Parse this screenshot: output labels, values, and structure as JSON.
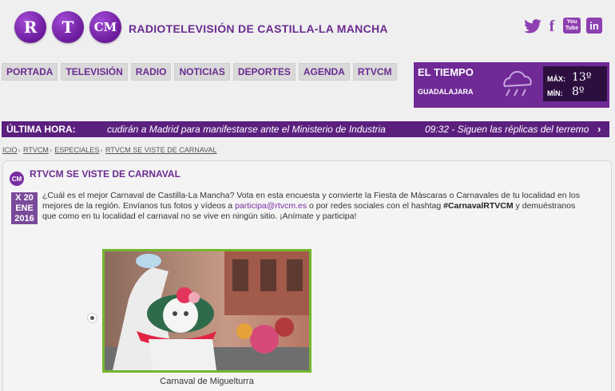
{
  "header": {
    "logo": [
      "R",
      "T",
      "CM"
    ],
    "brand": "RADIOTELEVISIÓN DE CASTILLA-LA MANCHA",
    "social": {
      "youtube_top": "You",
      "youtube_bottom": "Tube",
      "facebook": "f",
      "linkedin": "in"
    }
  },
  "nav": [
    "PORTADA",
    "TELEVISIÓN",
    "RADIO",
    "NOTICIAS",
    "DEPORTES",
    "AGENDA",
    "RTVCM"
  ],
  "weather": {
    "title": "EL TIEMPO",
    "city": "GUADALAJARA",
    "max_label": "MÁX:",
    "max_value": "13º",
    "min_label": "MÍN:",
    "min_value": "8º"
  },
  "breaking": {
    "label": "ÚLTIMA HORA:",
    "item1": "cudirán a Madrid para manifestarse ante el Ministerio de Industria",
    "item2": "09:32 - Siguen las réplicas del terremo",
    "arrow": "›"
  },
  "breadcrumb": [
    "ICIO",
    "RTVCM",
    "ESPECIALES",
    "RTVCM SE VISTE DE CARNAVAL"
  ],
  "article": {
    "icon": "CM",
    "title": "RTVCM SE VISTE DE CARNAVAL",
    "date": {
      "weekday": "X 20",
      "month": "ENE",
      "year": "2016"
    },
    "text_before_link": "¿Cuál es el mejor Carnaval de Castilla-La Mancha? Vota en esta encuesta y convierte la Fiesta de Máscaras o Carnavales de tu localidad en los mejores de la región. Envíanos tus fotos y vídeos a ",
    "link": "participa@rtvcm.es",
    "text_middle": " o por redes sociales con el hashtag ",
    "hashtag": "#CarnavalRTVCM",
    "text_after": " y demuéstranos que como en tu localidad el carnaval no se vive en ningún sitio. ¡Anímate y participa!",
    "photo_caption": "Carnaval de Miguelturra"
  },
  "colors": {
    "brand_purple": "#6b2c91",
    "dark_purple": "#5b1f7e",
    "photo_border": "#74b72e"
  }
}
